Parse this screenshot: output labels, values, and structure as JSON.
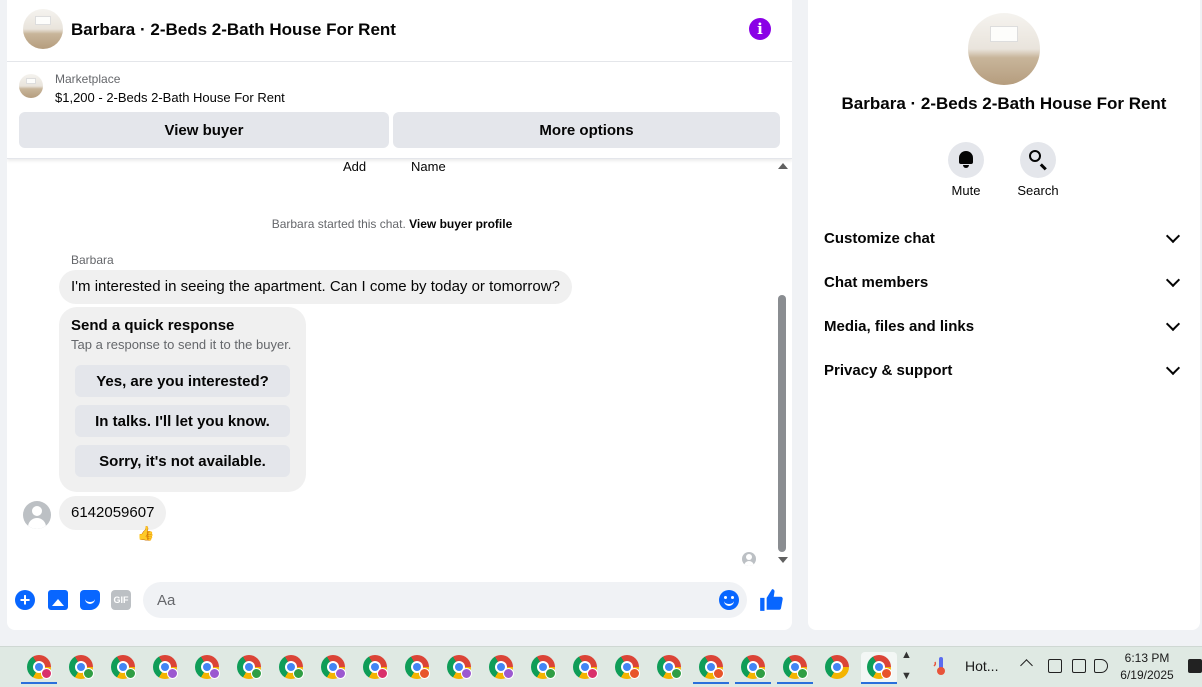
{
  "header": {
    "title": "Barbara · 2-Beds 2-Bath House For Rent",
    "info_icon": "info-icon",
    "info_glyph": "i"
  },
  "marketplace": {
    "label": "Marketplace",
    "listing": "$1,200 - 2-Beds 2-Bath House For Rent",
    "view_buyer_label": "View buyer",
    "more_options_label": "More options"
  },
  "messages": {
    "cut_left": "Add",
    "cut_right": "Name",
    "system_prefix": "Barbara started this chat.",
    "system_link": "View buyer profile",
    "sender": "Barbara",
    "first_message": "I'm interested in seeing the apartment. Can I come by today or tomorrow?",
    "quick_response": {
      "title": "Send a quick response",
      "subtitle": "Tap a response to send it to the buyer.",
      "options": [
        "Yes, are you interested?",
        "In talks. I'll let you know.",
        "Sorry, it's not available."
      ]
    },
    "second_message": "6142059607",
    "reaction": "👍"
  },
  "composer": {
    "placeholder": "Aa",
    "icons": [
      "plus-icon",
      "photo-icon",
      "sticker-icon",
      "gif-icon",
      "emoji-icon",
      "thumbs-up-icon"
    ],
    "plus_glyph": "+",
    "gif_label": "GIF"
  },
  "info_panel": {
    "title": "Barbara · 2-Beds 2-Bath House For Rent",
    "actions": [
      "Mute",
      "Search"
    ],
    "sections": [
      "Customize chat",
      "Chat members",
      "Media, files and links",
      "Privacy & support"
    ]
  },
  "taskbar": {
    "weather_text": "Hot...",
    "time": "6:13 PM",
    "date": "6/19/2025",
    "app_count": 21,
    "colors": {
      "accent": "#0866ff",
      "info": "#8a00e6"
    }
  }
}
